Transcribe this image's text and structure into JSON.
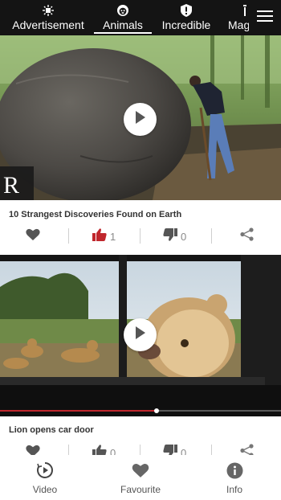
{
  "top_tabs": [
    {
      "label": "Advertisement",
      "icon": "sparkle-icon"
    },
    {
      "label": "Animals",
      "icon": "monkey-face-icon",
      "active": true
    },
    {
      "label": "Incredible",
      "icon": "shield-exclamation-icon"
    },
    {
      "label": "Mag",
      "icon": "magic-wand-icon"
    }
  ],
  "feed": [
    {
      "title": "10 Strangest Discoveries Found on Earth",
      "watermark": "R",
      "likes": "1",
      "dislikes": "0",
      "liked": true
    },
    {
      "title": "Lion opens car door",
      "likes": "0",
      "dislikes": "0",
      "liked": false
    }
  ],
  "bottom_nav": [
    {
      "label": "Video",
      "icon": "play-circle-icon"
    },
    {
      "label": "Favourite",
      "icon": "heart-icon"
    },
    {
      "label": "Info",
      "icon": "info-icon"
    }
  ],
  "colors": {
    "topbar_bg": "#141414",
    "liked_red": "#c0272d",
    "icon_gray": "#555555",
    "count_gray": "#8a8a8a"
  }
}
